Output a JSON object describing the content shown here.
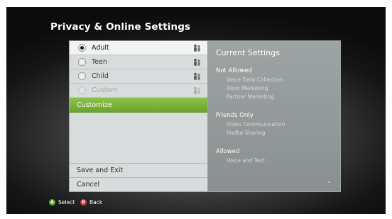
{
  "title": "Privacy & Online Settings",
  "menu": {
    "options": [
      {
        "label": "Adult",
        "selected": true,
        "enabled": true,
        "icon": "people-icon"
      },
      {
        "label": "Teen",
        "selected": false,
        "enabled": true,
        "icon": "people-icon"
      },
      {
        "label": "Child",
        "selected": false,
        "enabled": true,
        "icon": "people-icon"
      },
      {
        "label": "Custom",
        "selected": false,
        "enabled": false,
        "icon": "people-icon"
      }
    ],
    "customize_label": "Customize",
    "save_exit_label": "Save and Exit",
    "cancel_label": "Cancel"
  },
  "settings": {
    "title": "Current Settings",
    "sections": [
      {
        "heading": "Not Allowed",
        "items": [
          "Voice Data Collection",
          "Xbox Marketing",
          "Partner Marketing"
        ]
      },
      {
        "heading": "Friends Only",
        "items": [
          "Video Communication",
          "Profile Sharing"
        ]
      },
      {
        "heading": "Allowed",
        "items": [
          "Voice and Text"
        ]
      }
    ],
    "scroll_indicator": "⌄"
  },
  "footer": {
    "select_button": "A",
    "select_label": "Select",
    "back_button": "B",
    "back_label": "Back"
  },
  "colors": {
    "accent_green": "#6aa22e",
    "a_button": "#5aa832",
    "b_button": "#d33a2c"
  }
}
